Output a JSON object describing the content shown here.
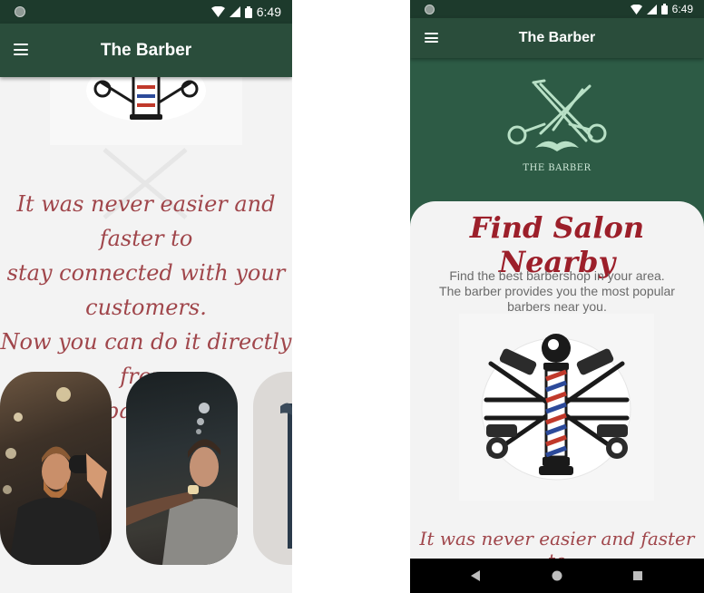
{
  "status": {
    "time": "6:49"
  },
  "app": {
    "title": "The Barber",
    "logo_text": "THE BARBER"
  },
  "left_screen": {
    "intro_text": [
      "It was never easier and faster to",
      "stay connected with your customers.",
      "Now you can do it directly from",
      "this barber app."
    ]
  },
  "right_screen": {
    "heading": "Find Salon Nearby",
    "description": [
      "Find the best barbershop in your area.",
      "The barber provides you the most popular",
      "barbers near you."
    ],
    "intro_text": "It was never easier and faster to"
  },
  "colors": {
    "appbar": "#2a4d3b",
    "statusbar": "#1d3a2c",
    "hero": "#2d5b45",
    "accent": "#a0464b",
    "heading": "#9c1f2a"
  },
  "icons": {
    "menu": "hamburger-menu-icon",
    "wifi": "wifi-icon",
    "signal": "signal-icon",
    "battery": "battery-icon",
    "back": "back-icon",
    "home": "home-icon",
    "recents": "recents-icon"
  }
}
